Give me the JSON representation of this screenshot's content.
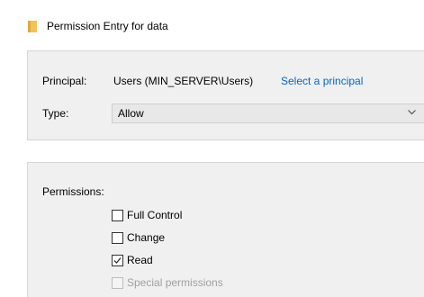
{
  "window": {
    "title": "Permission Entry for data",
    "title_icon": "folder-icon"
  },
  "principal": {
    "label": "Principal:",
    "value": "Users (MIN_SERVER\\Users)",
    "link": "Select a principal"
  },
  "type": {
    "label": "Type:",
    "selected": "Allow"
  },
  "permissions": {
    "label": "Permissions:",
    "items": [
      {
        "label": "Full Control",
        "checked": false,
        "disabled": false
      },
      {
        "label": "Change",
        "checked": false,
        "disabled": false
      },
      {
        "label": "Read",
        "checked": true,
        "disabled": false
      },
      {
        "label": "Special permissions",
        "checked": false,
        "disabled": true
      }
    ]
  },
  "colors": {
    "link": "#0066cc",
    "panel_bg": "#f0f0f0",
    "folder": "#f2c357"
  }
}
